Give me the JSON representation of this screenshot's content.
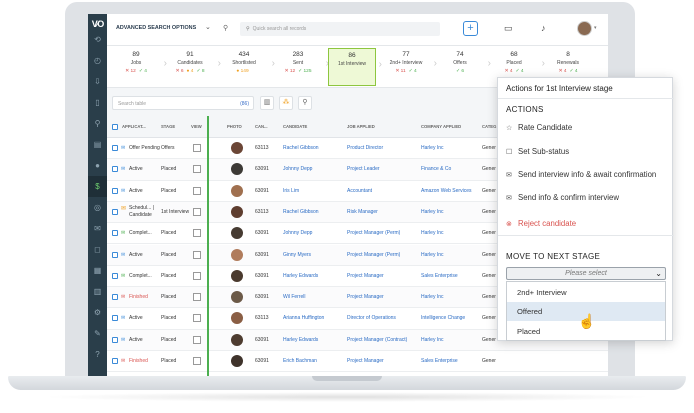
{
  "topbar": {
    "adv_search": "ADVANCED SEARCH OPTIONS",
    "search_placeholder": "Quick search all records",
    "plus": "+"
  },
  "pipeline": [
    {
      "num": "89",
      "label": "Jobs",
      "x": "12",
      "o": "",
      "c": "4"
    },
    {
      "num": "91",
      "label": "Candidates",
      "x": "6",
      "o": "4",
      "c": "8"
    },
    {
      "num": "434",
      "label": "Shortlisted",
      "x": "",
      "o": "149",
      "c": ""
    },
    {
      "num": "283",
      "label": "Sent",
      "x": "12",
      "o": "",
      "c": "125"
    },
    {
      "num": "86",
      "label": "1st Interview",
      "x": "",
      "o": "",
      "c": "",
      "active": true
    },
    {
      "num": "77",
      "label": "2nd+ Interview",
      "x": "11",
      "o": "",
      "c": "4"
    },
    {
      "num": "74",
      "label": "Offers",
      "x": "",
      "o": "",
      "c": "6"
    },
    {
      "num": "68",
      "label": "Placed",
      "x": "4",
      "o": "",
      "c": "4"
    },
    {
      "num": "8",
      "label": "Renewals",
      "x": "4",
      "o": "",
      "c": "4"
    }
  ],
  "toolbar": {
    "search_placeholder": "Search table",
    "count": "(86)"
  },
  "table": {
    "headers": {
      "status": "APPLICAT...",
      "stage": "STAGE",
      "view": "VIEW",
      "photo": "PHOTO",
      "can": "CAN...",
      "candidate": "CANDIDATE",
      "job": "JOB APPLIED",
      "company": "COMPANY APPLIED",
      "category": "CATEG"
    },
    "rows": [
      {
        "status": "Offer Pending",
        "stage": "Offers",
        "id": "63113",
        "candidate": "Rachel Gibbson",
        "job": "Product Director",
        "company": "Harley Inc",
        "cat": "Gener",
        "mail": "",
        "photo": "#6b4636"
      },
      {
        "status": "Active",
        "stage": "Placed",
        "id": "63091",
        "candidate": "Johnny Depp",
        "job": "Project Leader",
        "company": "Finance & Co",
        "cat": "Gener",
        "mail": "",
        "photo": "#3d3a36"
      },
      {
        "status": "Active",
        "stage": "Placed",
        "id": "63091",
        "candidate": "Iris Lim",
        "job": "Accountant",
        "company": "Amazon Web Services",
        "cat": "Gener",
        "mail": "",
        "photo": "#a0704f"
      },
      {
        "status": "Schedul... | Candidate",
        "stage": "1st Interview",
        "id": "63113",
        "candidate": "Rachel Gibbson",
        "job": "Risk Manager",
        "company": "Harley Inc",
        "cat": "Gener",
        "mail": "orange",
        "photo": "#5e3d2f"
      },
      {
        "status": "Complet...",
        "stage": "Placed",
        "id": "63091",
        "candidate": "Johnny Depp",
        "job": "Project Manager (Perm)",
        "company": "Harley Inc",
        "cat": "Gener",
        "mail": "green",
        "photo": "#463b32"
      },
      {
        "status": "Active",
        "stage": "Placed",
        "id": "63091",
        "candidate": "Ginny Myers",
        "job": "Project Manager (Perm)",
        "company": "Harley Inc",
        "cat": "Gener",
        "mail": "",
        "photo": "#b07c5c"
      },
      {
        "status": "Complet...",
        "stage": "Placed",
        "id": "63091",
        "candidate": "Harley Edwards",
        "job": "Project Manager",
        "company": "Sales Enterprise",
        "cat": "Gener",
        "mail": "green",
        "photo": "#4a3a2e"
      },
      {
        "status": "Finished",
        "stage": "Placed",
        "id": "63091",
        "candidate": "Wil Ferrell",
        "job": "Project Manager",
        "company": "Harley Inc",
        "cat": "Gener",
        "mail": "red",
        "photo": "#6c5a48"
      },
      {
        "status": "Active",
        "stage": "Placed",
        "id": "63113",
        "candidate": "Arianna Huffington",
        "job": "Director of Operations",
        "company": "Intelligence Change",
        "cat": "Gener",
        "mail": "",
        "photo": "#8a5e44"
      },
      {
        "status": "Active",
        "stage": "Placed",
        "id": "63091",
        "candidate": "Harley Edwards",
        "job": "Project Manager (Contract)",
        "company": "Harley Inc",
        "cat": "Gener",
        "mail": "",
        "photo": "#4e3c30"
      },
      {
        "status": "Finished",
        "stage": "Placed",
        "id": "63091",
        "candidate": "Erich Bachman",
        "job": "Project Manager",
        "company": "Sales Enterprise",
        "cat": "Gener",
        "mail": "red",
        "photo": "#3f332b"
      }
    ]
  },
  "popup": {
    "title": "Actions for 1st Interview stage",
    "actions_heading": "ACTIONS",
    "items": [
      {
        "icon": "☆",
        "label": "Rate Candidate",
        "icon_name": "star-icon"
      },
      {
        "icon": "☐",
        "label": "Set Sub-status",
        "icon_name": "checkbox-icon"
      },
      {
        "icon": "✉",
        "label": "Send interview info & await confirmation",
        "icon_name": "envelope-icon"
      },
      {
        "icon": "✉",
        "label": "Send info & confirm interview",
        "icon_name": "envelope-icon"
      }
    ],
    "reject_label": "Reject candidate",
    "move_heading": "MOVE TO NEXT STAGE",
    "select_placeholder": "Please select",
    "options": [
      "2nd+ Interview",
      "Offered",
      "Placed"
    ],
    "highlighted_option": "Offered"
  },
  "colors": {
    "rail": "#2a3e4a",
    "accent": "#3a8ad8",
    "green": "#4caf50",
    "red": "#d9534f",
    "orange": "#f0a020"
  }
}
